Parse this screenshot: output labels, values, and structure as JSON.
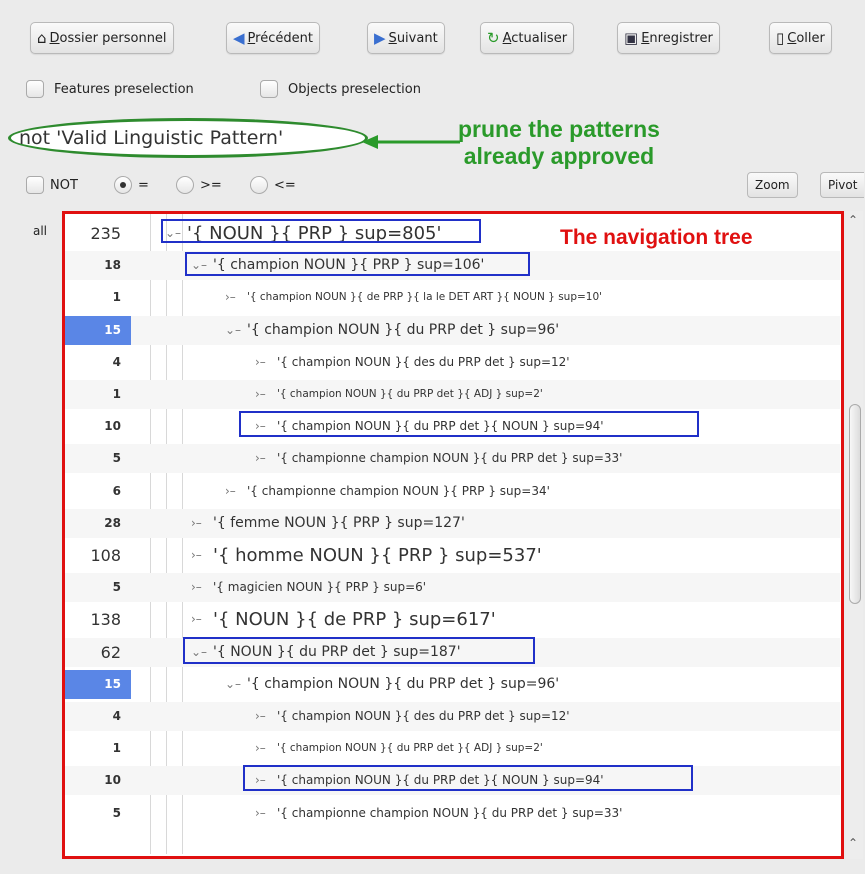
{
  "toolbar": {
    "home": "Dossier personnel",
    "back": "Précédent",
    "forward": "Suivant",
    "refresh": "Actualiser",
    "save": "Enregistrer",
    "paste": "Coller"
  },
  "preselection": {
    "features": "Features preselection",
    "objects": "Objects preselection"
  },
  "filter": {
    "value": "not 'Valid Linguistic Pattern'",
    "annotation_line1": "prune the patterns",
    "annotation_line2": "already approved"
  },
  "operators": {
    "not": "NOT",
    "eq": "=",
    "gte": ">=",
    "lte": "<="
  },
  "buttons": {
    "zoom": "Zoom",
    "pivot": "Pivot",
    "all": "all"
  },
  "tree": {
    "title": "The navigation tree",
    "rows": [
      {
        "count": "235",
        "label": "'{ NOUN }{ PRP } sup=805'",
        "expander": "v"
      },
      {
        "count": "18",
        "label": "'{ champion NOUN }{ PRP } sup=106'",
        "expander": "v"
      },
      {
        "count": "1",
        "label": "'{ champion NOUN }{ de PRP }{ la le DET ART }{ NOUN } sup=10'",
        "expander": ">"
      },
      {
        "count": "15",
        "label": "'{ champion NOUN }{ du PRP det } sup=96'",
        "expander": "v"
      },
      {
        "count": "4",
        "label": "'{ champion NOUN }{ des du PRP det } sup=12'",
        "expander": ">"
      },
      {
        "count": "1",
        "label": "'{ champion NOUN }{ du PRP det }{ ADJ } sup=2'",
        "expander": ">"
      },
      {
        "count": "10",
        "label": "'{ champion NOUN }{ du PRP det }{ NOUN } sup=94'",
        "expander": ">"
      },
      {
        "count": "5",
        "label": "'{ championne champion NOUN }{ du PRP det } sup=33'",
        "expander": ">"
      },
      {
        "count": "6",
        "label": "'{ championne champion NOUN }{ PRP } sup=34'",
        "expander": ">"
      },
      {
        "count": "28",
        "label": "'{ femme NOUN }{ PRP } sup=127'",
        "expander": ">"
      },
      {
        "count": "108",
        "label": "'{ homme NOUN }{ PRP } sup=537'",
        "expander": ">"
      },
      {
        "count": "5",
        "label": "'{ magicien NOUN }{ PRP } sup=6'",
        "expander": ">"
      },
      {
        "count": "138",
        "label": "'{ NOUN }{ de PRP } sup=617'",
        "expander": ">"
      },
      {
        "count": "62",
        "label": "'{ NOUN }{ du PRP det } sup=187'",
        "expander": "v"
      },
      {
        "count": "15",
        "label": "'{ champion NOUN }{ du PRP det } sup=96'",
        "expander": "v"
      },
      {
        "count": "4",
        "label": "'{ champion NOUN }{ des du PRP det } sup=12'",
        "expander": ">"
      },
      {
        "count": "1",
        "label": "'{ champion NOUN }{ du PRP det }{ ADJ } sup=2'",
        "expander": ">"
      },
      {
        "count": "10",
        "label": "'{ champion NOUN }{ du PRP det }{ NOUN } sup=94'",
        "expander": ">"
      },
      {
        "count": "5",
        "label": "'{ championne champion NOUN }{ du PRP det } sup=33'",
        "expander": ">"
      }
    ]
  },
  "colors": {
    "annotation_green": "#2a9a2a",
    "annotation_red": "#e01010",
    "box_blue": "#2030c8",
    "selected_row": "#5a86e6"
  }
}
